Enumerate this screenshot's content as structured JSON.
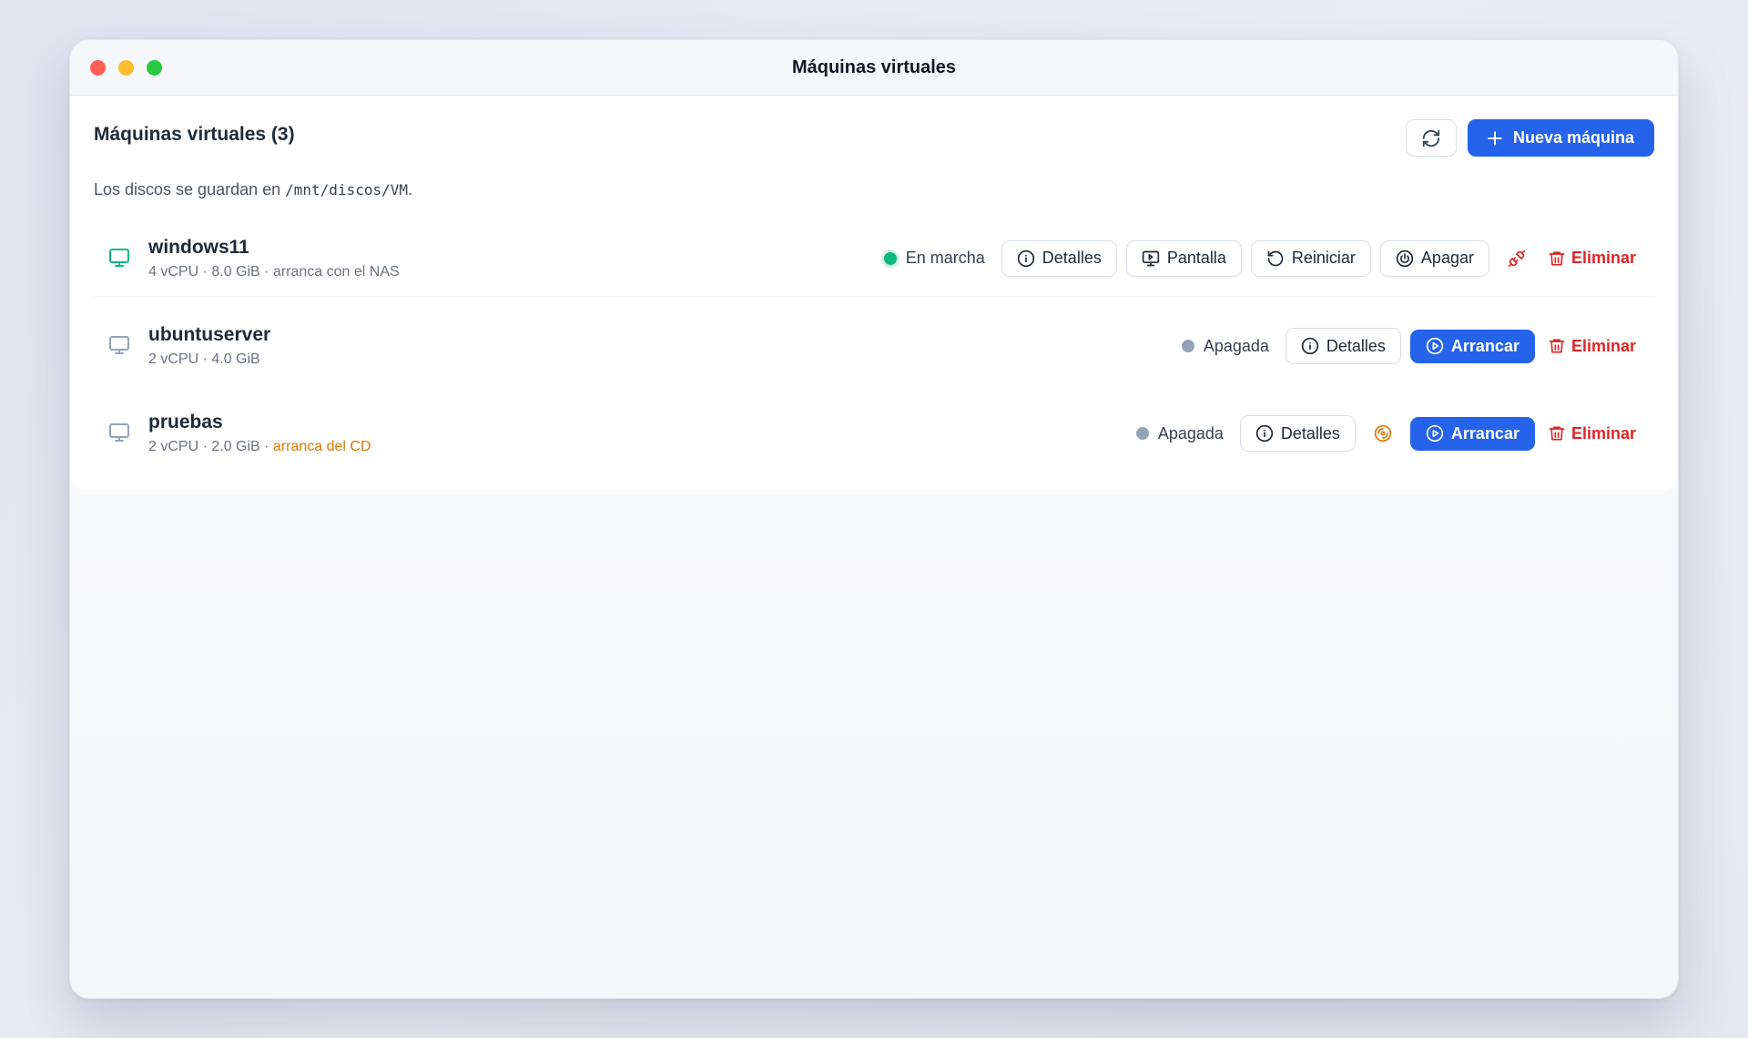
{
  "window": {
    "title": "Máquinas virtuales"
  },
  "header": {
    "title": "Máquinas virtuales (3)",
    "new_button": "Nueva máquina"
  },
  "note": {
    "prefix": "Los discos se guardan en ",
    "path": "/mnt/discos/VM",
    "suffix": "."
  },
  "vms": [
    {
      "name": "windows11",
      "meta": "4 vCPU · 8.0 GiB · arranca con el NAS",
      "status": "En marcha",
      "buttons": {
        "details": "Detalles",
        "screen": "Pantalla",
        "restart": "Reiniciar",
        "shutdown": "Apagar",
        "delete": "Eliminar"
      }
    },
    {
      "name": "ubuntuserver",
      "meta": "2 vCPU · 4.0 GiB",
      "status": "Apagada",
      "buttons": {
        "details": "Detalles",
        "start": "Arrancar",
        "delete": "Eliminar"
      }
    },
    {
      "name": "pruebas",
      "meta": "2 vCPU · 2.0 GiB · ",
      "meta_warn": "arranca del CD",
      "status": "Apagada",
      "buttons": {
        "details": "Detalles",
        "start": "Arrancar",
        "delete": "Eliminar"
      }
    }
  ],
  "colors": {
    "accent": "#2563eb",
    "running": "#10b981",
    "stopped": "#94a3b8",
    "danger": "#dc2626",
    "warning": "#d97706"
  },
  "icons": [
    "refresh-icon",
    "plus-icon",
    "monitor-icon",
    "info-icon",
    "screen-icon",
    "restart-icon",
    "power-icon",
    "unplug-icon",
    "trash-icon",
    "play-icon",
    "disc-icon"
  ]
}
